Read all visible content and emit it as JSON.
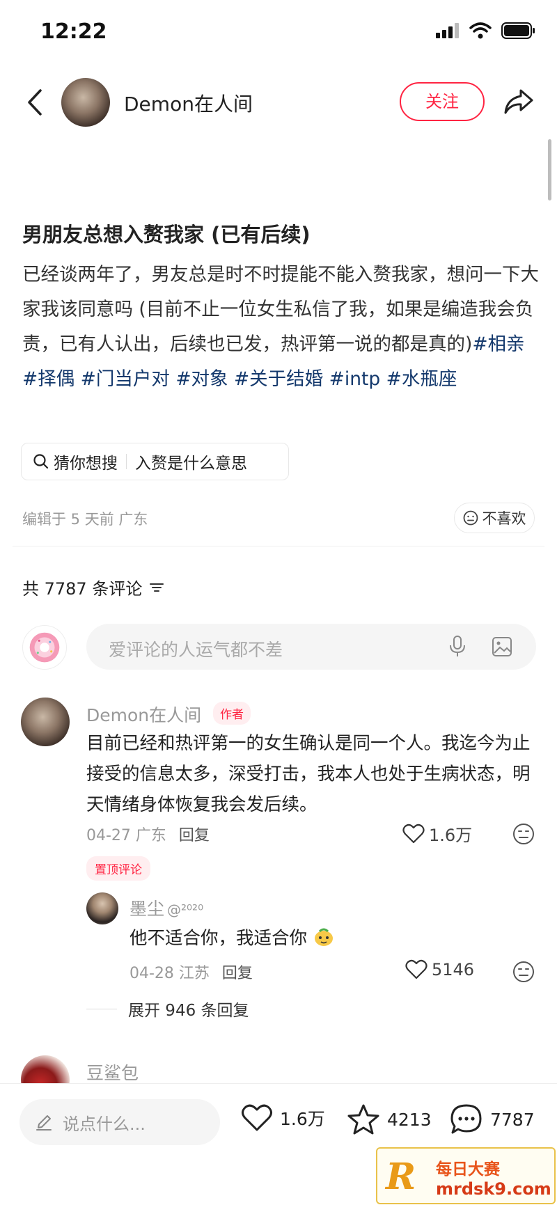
{
  "status_bar": {
    "time": "12:22"
  },
  "nav": {
    "author_name": "Demon在人间",
    "follow_label": "关注"
  },
  "post": {
    "title": "男朋友总想入赘我家 (已有后续)",
    "body": "已经谈两年了，男友总是时不时提能不能入赘我家，想问一下大家我该同意吗 (目前不止一位女生私信了我，如果是编造我会负责，已有人认出，后续也已发，热评第一说的都是真的)",
    "tags": [
      "#相亲",
      "#择偶",
      "#门当户对",
      "#对象",
      "#关于结婚",
      "#intp",
      "#水瓶座"
    ],
    "guess_label": "猜你想搜",
    "guess_query": "入赘是什么意思",
    "edited": "编辑于 5 天前 广东",
    "dislike_label": "不喜欢"
  },
  "comments_header": {
    "count_text": "共 7787 条评论"
  },
  "comment_input": {
    "placeholder": "爱评论的人运气都不差"
  },
  "comments": [
    {
      "user": "Demon在人间",
      "badge": "作者",
      "text": "目前已经和热评第一的女生确认是同一个人。我迄今为止接受的信息太多，深受打击，我本人也处于生病状态，明天情绪身体恢复我会发后续。",
      "date_loc": "04-27 广东",
      "reply_label": "回复",
      "likes": "1.6万",
      "pinned_label": "置顶评论"
    }
  ],
  "reply": {
    "user": "墨尘",
    "user_suffix": "@²⁰²⁰",
    "text": "他不适合你，我适合你",
    "date_loc": "04-28 江苏",
    "reply_label": "回复",
    "likes": "5146",
    "expand_label": "展开 946 条回复"
  },
  "next_comment": {
    "user": "豆鲨包"
  },
  "bottom_bar": {
    "input_placeholder": "说点什么...",
    "likes": "1.6万",
    "stars": "4213",
    "comments": "7787"
  },
  "watermark": {
    "logo": "R",
    "title": "每日大赛",
    "url": "mrdsk9.com"
  },
  "colors": {
    "accent": "#ff2442",
    "tag": "#13386c",
    "muted": "#999999"
  }
}
